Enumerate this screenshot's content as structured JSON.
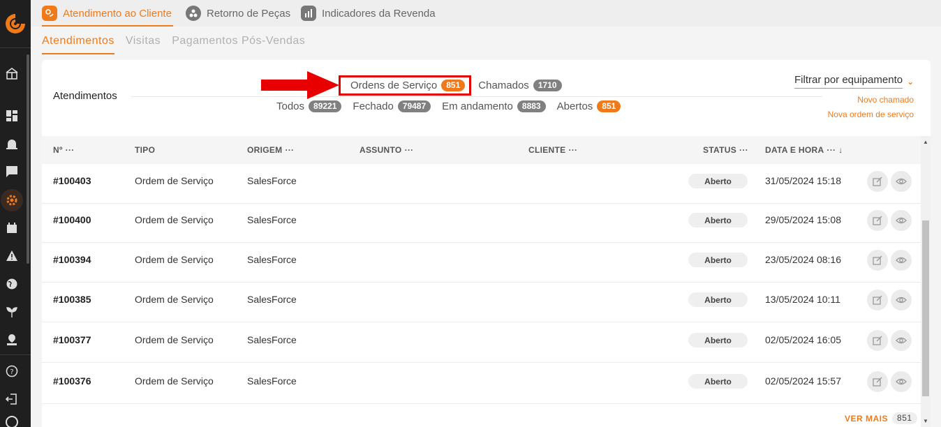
{
  "top_tabs": [
    {
      "label": "Atendimento ao Cliente",
      "icon": "customer-service-icon",
      "active": true
    },
    {
      "label": "Retorno de Peças",
      "icon": "parts-return-icon",
      "active": false
    },
    {
      "label": "Indicadores da Revenda",
      "icon": "bar-chart-icon",
      "active": false
    }
  ],
  "sub_tabs": [
    {
      "label": "Atendimentos",
      "active": true
    },
    {
      "label": "Visitas",
      "active": false
    },
    {
      "label": "Pagamentos Pós-Vendas",
      "active": false
    }
  ],
  "card": {
    "title": "Atendimentos",
    "type_filters": [
      {
        "label": "Ordens de Serviço",
        "count": "851",
        "highlighted": true
      },
      {
        "label": "Chamados",
        "count": "1710",
        "highlighted": false
      }
    ],
    "status_filters": [
      {
        "label": "Todos",
        "count": "89221"
      },
      {
        "label": "Fechado",
        "count": "79487"
      },
      {
        "label": "Em andamento",
        "count": "8883"
      },
      {
        "label": "Abertos",
        "count": "851"
      }
    ],
    "equipment_filter": "Filtrar por equipamento",
    "new_ticket_link": "Novo chamado",
    "new_order_link": "Nova ordem de serviço"
  },
  "table": {
    "columns": {
      "number": "Nº",
      "type": "TIPO",
      "origin": "ORIGEM",
      "subject": "ASSUNTO",
      "client": "CLIENTE",
      "status": "STATUS",
      "datetime": "DATA E HORA"
    },
    "rows": [
      {
        "number": "#100403",
        "type": "Ordem de Serviço",
        "origin": "SalesForce",
        "subject": "",
        "client": "",
        "status": "Aberto",
        "datetime": "31/05/2024 15:18"
      },
      {
        "number": "#100400",
        "type": "Ordem de Serviço",
        "origin": "SalesForce",
        "subject": "",
        "client": "",
        "status": "Aberto",
        "datetime": "29/05/2024 15:08"
      },
      {
        "number": "#100394",
        "type": "Ordem de Serviço",
        "origin": "SalesForce",
        "subject": "",
        "client": "",
        "status": "Aberto",
        "datetime": "23/05/2024 08:16"
      },
      {
        "number": "#100385",
        "type": "Ordem de Serviço",
        "origin": "SalesForce",
        "subject": "",
        "client": "",
        "status": "Aberto",
        "datetime": "13/05/2024 10:11"
      },
      {
        "number": "#100377",
        "type": "Ordem de Serviço",
        "origin": "SalesForce",
        "subject": "",
        "client": "",
        "status": "Aberto",
        "datetime": "02/05/2024 16:05"
      },
      {
        "number": "#100376",
        "type": "Ordem de Serviço",
        "origin": "SalesForce",
        "subject": "",
        "client": "",
        "status": "Aberto",
        "datetime": "02/05/2024 15:57"
      }
    ]
  },
  "footer": {
    "see_more": "VER MAIS",
    "count": "851"
  },
  "colors": {
    "accent": "#f07a1a",
    "sidebar": "#1f1f1f",
    "highlight": "#e00000"
  }
}
